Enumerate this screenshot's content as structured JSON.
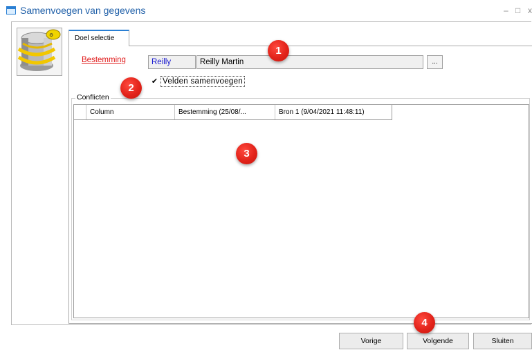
{
  "window": {
    "title": "Samenvoegen van gegevens",
    "icon": "window-icon",
    "minimize_glyph": "–",
    "maximize_glyph": "□",
    "close_glyph": "x"
  },
  "tab": {
    "label": "Doel selectie"
  },
  "destination": {
    "label": "Bestemming",
    "code": "Reilly",
    "name": "Reilly Martin",
    "browse_label": "..."
  },
  "merge_fields": {
    "label": "Velden samenvoegen",
    "checked": true,
    "check_glyph": "✔"
  },
  "conflicts": {
    "label": "Conflicten",
    "columns": [
      "Column",
      "Bestemming (25/08/...",
      "Bron 1 (9/04/2021 11:48:11)"
    ],
    "rows": []
  },
  "buttons": {
    "previous": "Vorige",
    "next": "Volgende",
    "close": "Sluiten"
  },
  "callouts": [
    "1",
    "2",
    "3",
    "4"
  ],
  "colors": {
    "accent": "#2a7fd3",
    "label_red": "#e01a1a",
    "callout_red": "#e2231a",
    "code_blue": "#1a1ad0"
  }
}
